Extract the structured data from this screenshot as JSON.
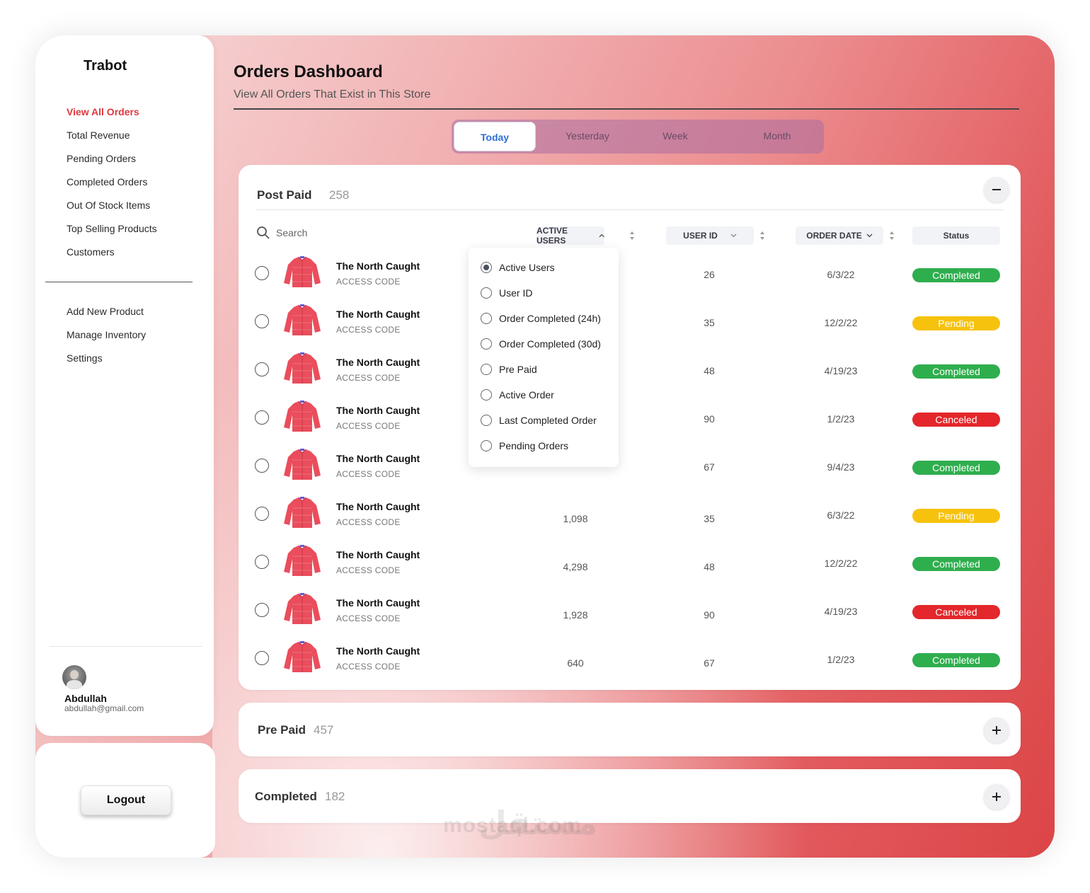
{
  "app": {
    "name": "Trabot"
  },
  "sidebar": {
    "nav": [
      {
        "label": "View All Orders",
        "active": true
      },
      {
        "label": "Total Revenue"
      },
      {
        "label": "Pending Orders"
      },
      {
        "label": "Completed Orders"
      },
      {
        "label": "Out Of Stock Items"
      },
      {
        "label": "Top Selling Products"
      },
      {
        "label": "Customers"
      }
    ],
    "nav2": [
      {
        "label": "Add New Product"
      },
      {
        "label": "Manage Inventory"
      },
      {
        "label": "Settings"
      }
    ],
    "user": {
      "name": "Abdullah",
      "email": "abdullah@gmail.com"
    },
    "logout_label": "Logout"
  },
  "header": {
    "title": "Orders Dashboard",
    "subtitle": "View All Orders That Exist in This Store"
  },
  "tabs": [
    {
      "label": "Today",
      "active": true
    },
    {
      "label": "Yesterday"
    },
    {
      "label": "Week"
    },
    {
      "label": "Month"
    }
  ],
  "post_paid": {
    "title": "Post Paid",
    "count": "258",
    "search_placeholder": "Search",
    "columns": {
      "active_users": "ACTIVE USERS",
      "user_id": "USER ID",
      "order_date": "ORDER DATE",
      "status": "Status"
    },
    "rows": [
      {
        "name": "The North Caught",
        "code": "ACCESS CODE",
        "active_users": "",
        "user_id": "26",
        "date": "6/3/22",
        "status": "Completed"
      },
      {
        "name": "The North Caught",
        "code": "ACCESS CODE",
        "active_users": "",
        "user_id": "35",
        "date": "12/2/22",
        "status": "Pending"
      },
      {
        "name": "The North Caught",
        "code": "ACCESS CODE",
        "active_users": "",
        "user_id": "48",
        "date": "4/19/23",
        "status": "Completed"
      },
      {
        "name": "The North Caught",
        "code": "ACCESS CODE",
        "active_users": "",
        "user_id": "90",
        "date": "1/2/23",
        "status": "Canceled"
      },
      {
        "name": "The North Caught",
        "code": "ACCESS CODE",
        "active_users": "",
        "user_id": "67",
        "date": "9/4/23",
        "status": "Completed"
      },
      {
        "name": "The North Caught",
        "code": "ACCESS CODE",
        "active_users": "1,098",
        "user_id": "35",
        "date": "6/3/22",
        "status": "Pending"
      },
      {
        "name": "The North Caught",
        "code": "ACCESS CODE",
        "active_users": "4,298",
        "user_id": "48",
        "date": "12/2/22",
        "status": "Completed"
      },
      {
        "name": "The North Caught",
        "code": "ACCESS CODE",
        "active_users": "1,928",
        "user_id": "90",
        "date": "4/19/23",
        "status": "Canceled"
      },
      {
        "name": "The North Caught",
        "code": "ACCESS CODE",
        "active_users": "640",
        "user_id": "67",
        "date": "1/2/23",
        "status": "Completed"
      }
    ],
    "dropdown": [
      {
        "label": "Active Users",
        "checked": true
      },
      {
        "label": "User ID"
      },
      {
        "label": "Order Completed (24h)"
      },
      {
        "label": "Order Completed (30d)"
      },
      {
        "label": "Pre Paid"
      },
      {
        "label": "Active Order"
      },
      {
        "label": "Last Completed Order"
      },
      {
        "label": "Pending Orders"
      }
    ]
  },
  "pre_paid": {
    "title": "Pre Paid",
    "count": "457"
  },
  "completed": {
    "title": "Completed",
    "count": "182"
  },
  "watermark": {
    "arabic": "مستقل",
    "latin": "mostaql.com"
  },
  "colors": {
    "accent": "#e0373b",
    "completed": "#2fae4e",
    "pending": "#f7c20d",
    "canceled": "#e3272b",
    "tab_active_text": "#2f6fd6"
  }
}
